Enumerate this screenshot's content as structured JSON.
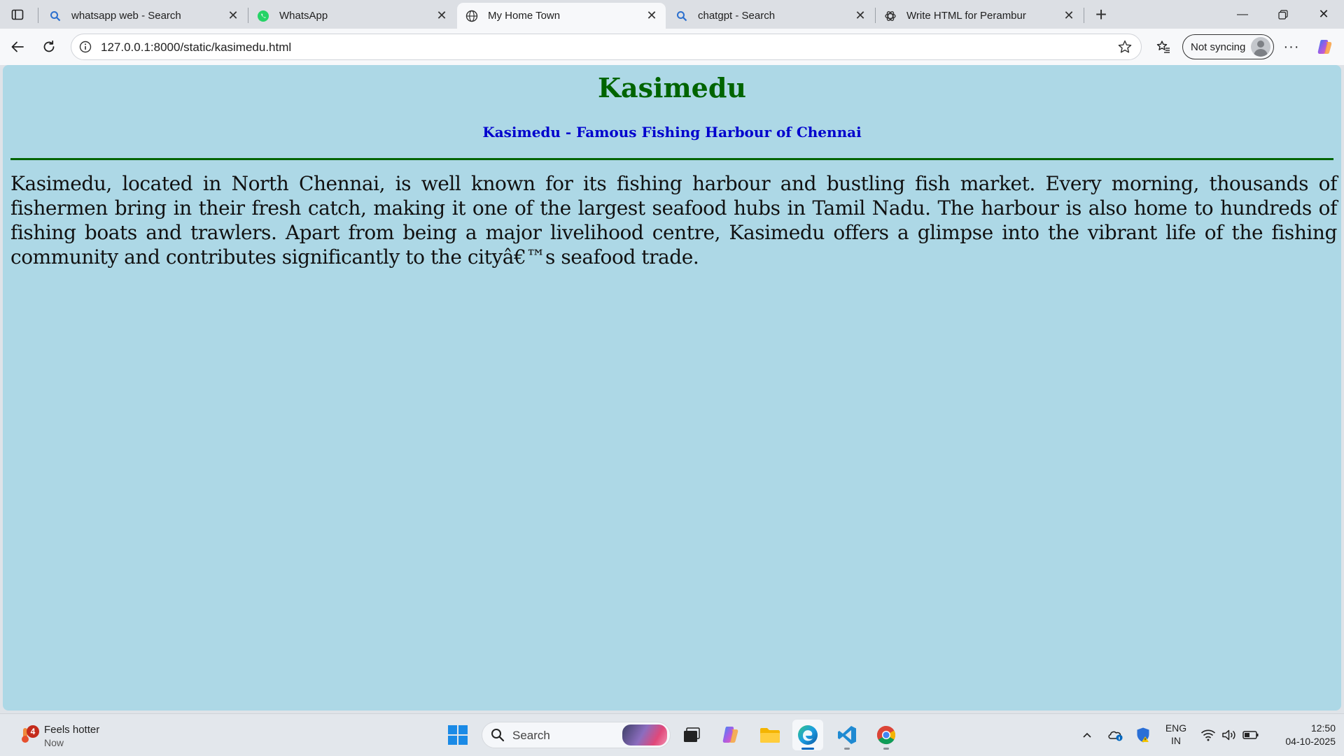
{
  "browser": {
    "tabs": [
      {
        "title": "whatsapp web - Search",
        "icon": "search-icon",
        "active": false
      },
      {
        "title": "WhatsApp",
        "icon": "whatsapp-icon",
        "active": false
      },
      {
        "title": "My Home Town",
        "icon": "globe-icon",
        "active": true
      },
      {
        "title": "chatgpt - Search",
        "icon": "search-icon",
        "active": false
      },
      {
        "title": "Write HTML for Perambur",
        "icon": "chatgpt-icon",
        "active": false
      }
    ],
    "address": "127.0.0.1:8000/static/kasimedu.html",
    "sync_label": "Not syncing"
  },
  "page": {
    "title": "Kasimedu",
    "subtitle": "Kasimedu - Famous Fishing Harbour of Chennai",
    "paragraph": "Kasimedu, located in North Chennai, is well known for its fishing harbour and bustling fish market. Every morning, thousands of fishermen bring in their fresh catch, making it one of the largest seafood hubs in Tamil Nadu. The harbour is also home to hundreds of fishing boats and trawlers. Apart from being a major livelihood centre, Kasimedu offers a glimpse into the vibrant life of the fishing community and contributes significantly to the cityâ€™s seafood trade.",
    "background_color": "#add8e6",
    "title_color": "#006400",
    "subtitle_color": "#0000cd"
  },
  "taskbar": {
    "weather": {
      "badge": "4",
      "text": "Feels hotter",
      "time": "Now"
    },
    "search_placeholder": "Search",
    "language": {
      "line1": "ENG",
      "line2": "IN"
    },
    "clock": {
      "time": "12:50",
      "date": "04-10-2025"
    }
  }
}
